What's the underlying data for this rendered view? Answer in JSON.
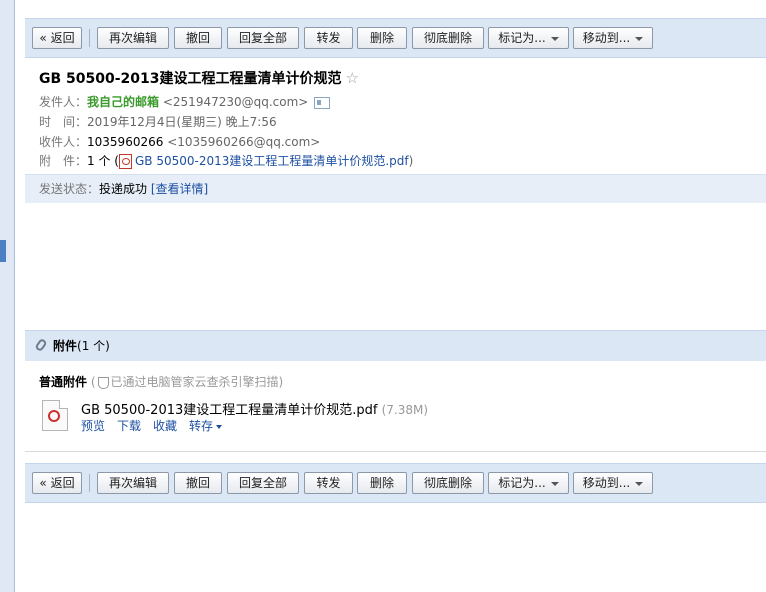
{
  "toolbar": {
    "back": "« 返回",
    "re_edit": "再次编辑",
    "recall": "撤回",
    "reply_all": "回复全部",
    "forward": "转发",
    "delete": "删除",
    "delete_forever": "彻底删除",
    "mark_as": "标记为...",
    "move_to": "移动到..."
  },
  "mail": {
    "subject": "GB 50500-2013建设工程工程量清单计价规范",
    "star": "☆",
    "from_label": "发件人：",
    "from_name": "我自己的邮箱",
    "from_addr": "<251947230@qq.com>",
    "time_label": "时　间：",
    "time_value": "2019年12月4日(星期三) 晚上7:56",
    "to_label": "收件人：",
    "to_name": "1035960266",
    "to_addr": "<1035960266@qq.com>",
    "attach_label": "附　件：",
    "attach_count": "1 个 (",
    "attach_file": "GB 50500-2013建设工程工程量清单计价规范.pdf",
    "attach_close": ")",
    "status_label": "发送状态：",
    "status_value": "投递成功",
    "status_link": "[查看详情]"
  },
  "attachments": {
    "title": "附件",
    "count": "(1 个)",
    "normal_title": "普通附件",
    "scan_note_open": "(",
    "scan_note": "已通过电脑管家云查杀引擎扫描)",
    "file_name": "GB 50500-2013建设工程工程量清单计价规范.pdf",
    "file_size": "(7.38M)",
    "actions": {
      "preview": "预览",
      "download": "下载",
      "collect": "收藏",
      "save_to": "转存"
    }
  },
  "colors": {
    "toolbar_bg": "#dce7f5",
    "link": "#1e50a2",
    "sender_green": "#3a9a2b"
  },
  "icons": [
    "star-icon",
    "contact-card-icon",
    "pdf-icon",
    "paperclip-icon",
    "shield-icon",
    "chevron-down-icon"
  ]
}
